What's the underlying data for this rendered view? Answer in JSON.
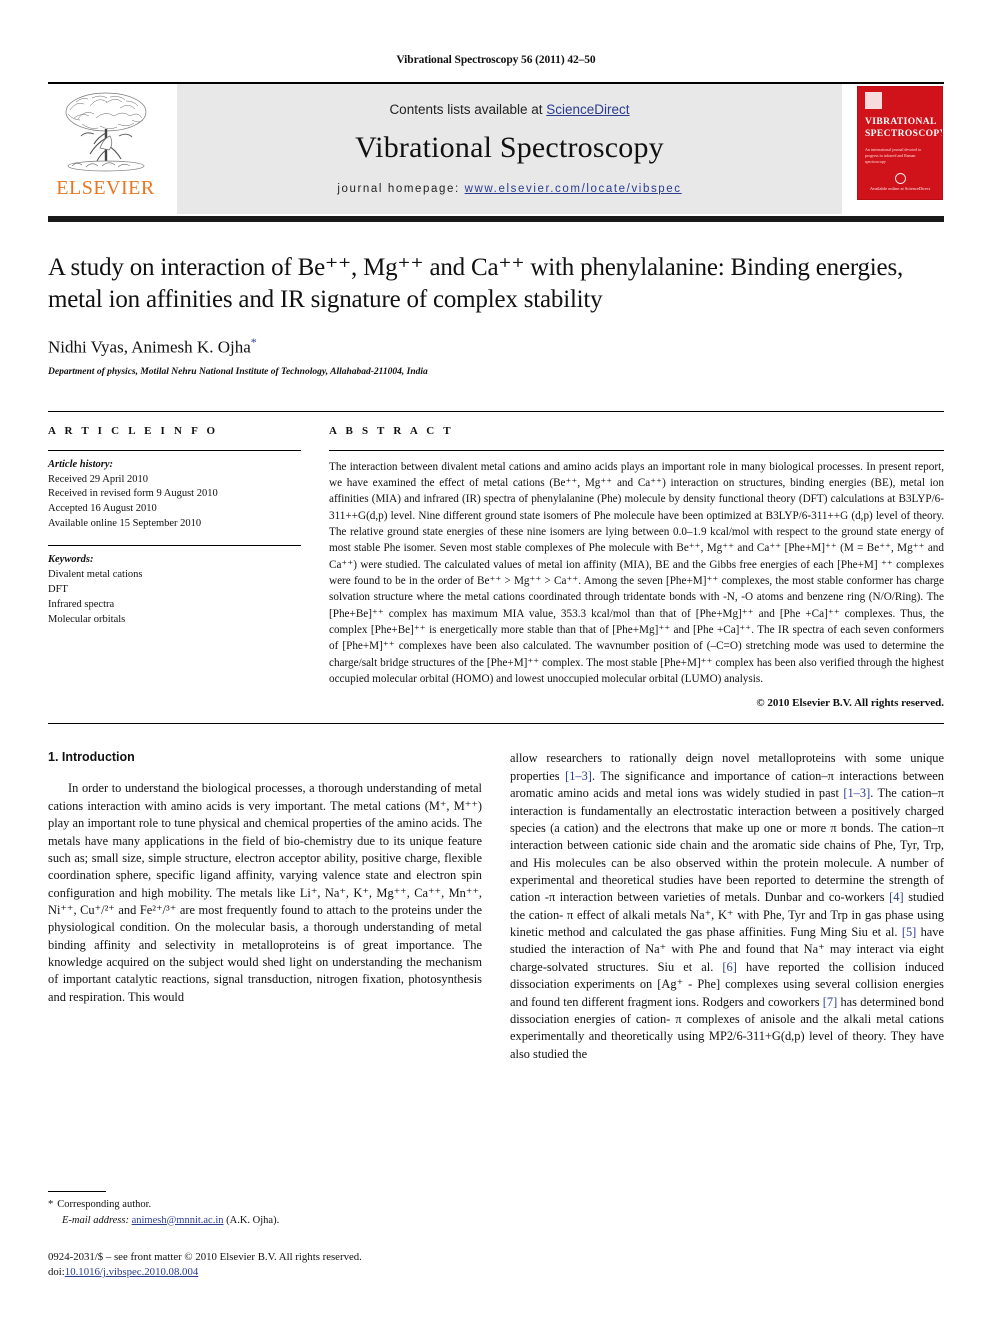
{
  "running_head": "Vibrational Spectroscopy 56 (2011) 42–50",
  "masthead": {
    "publisher_name": "ELSEVIER",
    "contents_prefix": "Contents lists available at ",
    "contents_link": "ScienceDirect",
    "journal_name": "Vibrational Spectroscopy",
    "homepage_label": "journal homepage: ",
    "homepage_url": "www.elsevier.com/locate/vibspec",
    "cover": {
      "title_line1": "VIBRATIONAL",
      "title_line2": "SPECTROSCOPY",
      "subtitle": "An international journal devoted to progress in infrared and Raman spectroscopy",
      "footer": "Available online at ScienceDirect"
    }
  },
  "article": {
    "title": "A study on interaction of Be⁺⁺, Mg⁺⁺ and Ca⁺⁺ with phenylalanine: Binding energies, metal ion affinities and IR signature of complex stability",
    "authors": "Nidhi Vyas, Animesh K. Ojha",
    "corresponding_marker": "*",
    "affiliation": "Department of physics, Motilal Nehru National Institute of Technology, Allahabad-211004, India"
  },
  "article_info": {
    "heading": "A R T I C L E   I N F O",
    "history_label": "Article history:",
    "history": [
      "Received 29 April 2010",
      "Received in revised form 9 August 2010",
      "Accepted 16 August 2010",
      "Available online 15 September 2010"
    ],
    "keywords_label": "Keywords:",
    "keywords": [
      "Divalent metal cations",
      "DFT",
      "Infrared spectra",
      "Molecular orbitals"
    ]
  },
  "abstract": {
    "heading": "A B S T R A C T",
    "text": "The interaction between divalent metal cations and amino acids plays an important role in many biological processes. In present report, we have examined the effect of metal cations (Be⁺⁺, Mg⁺⁺ and Ca⁺⁺) interaction on structures, binding energies (BE), metal ion affinities (MIA) and infrared (IR) spectra of phenylalanine (Phe) molecule by density functional theory (DFT) calculations at B3LYP/6-311++G(d,p) level. Nine different ground state isomers of Phe molecule have been optimized at B3LYP/6-311++G (d,p) level of theory. The relative ground state energies of these nine isomers are lying between 0.0–1.9 kcal/mol with respect to the ground state energy of most stable Phe isomer. Seven most stable complexes of Phe molecule with Be⁺⁺, Mg⁺⁺ and Ca⁺⁺ [Phe+M]⁺⁺ (M = Be⁺⁺, Mg⁺⁺ and Ca⁺⁺) were studied. The calculated values of metal ion affinity (MIA), BE and the Gibbs free energies of each [Phe+M] ⁺⁺ complexes were found to be in the order of Be⁺⁺ > Mg⁺⁺ > Ca⁺⁺. Among the seven [Phe+M]⁺⁺ complexes, the most stable conformer has charge solvation structure where the metal cations coordinated through tridentate bonds with -N, -O atoms and benzene ring (N/O/Ring). The [Phe+Be]⁺⁺ complex has maximum MIA value, 353.3 kcal/mol than that of [Phe+Mg]⁺⁺ and [Phe +Ca]⁺⁺ complexes. Thus, the complex [Phe+Be]⁺⁺ is energetically more stable than that of [Phe+Mg]⁺⁺ and [Phe +Ca]⁺⁺. The IR spectra of each seven conformers of [Phe+M]⁺⁺ complexes have been also calculated. The wavnumber position of (–C=O) stretching mode was used to determine the charge/salt bridge structures of the [Phe+M]⁺⁺ complex. The most stable [Phe+M]⁺⁺ complex has been also verified through the highest occupied molecular orbital (HOMO) and lowest unoccupied molecular orbital (LUMO) analysis.",
    "copyright": "© 2010 Elsevier B.V. All rights reserved."
  },
  "body": {
    "section_heading": "1.  Introduction",
    "left_paragraph_1": "In order to understand the biological processes, a thorough understanding of metal cations interaction with amino acids is very important. The metal cations (M⁺, M⁺⁺) play an important role to tune physical and chemical properties of the amino acids. The metals have many applications in the field of bio-chemistry due to its unique feature such as; small size, simple structure, electron acceptor ability, positive charge, flexible coordination sphere, specific ligand affinity, varying valence state and electron spin configuration and high mobility. The metals like Li⁺, Na⁺, K⁺, Mg⁺⁺, Ca⁺⁺, Mn⁺⁺, Ni⁺⁺, Cu⁺/²⁺ and Fe²⁺/³⁺ are most frequently found to attach to the proteins under the physiological condition. On the molecular basis, a thorough understanding of metal binding affinity and selectivity in metalloproteins is of great importance. The knowledge acquired on the subject would shed light on understanding the mechanism of important catalytic reactions, signal transduction, nitrogen fixation, photosynthesis and respiration. This would",
    "right_paragraph_segments": [
      {
        "t": "allow researchers to rationally deign novel metalloproteins with some unique properties ",
        "k": "text"
      },
      {
        "t": "[1–3]",
        "k": "ref"
      },
      {
        "t": ". The significance and importance of cation–π interactions between aromatic amino acids and metal ions was widely studied in past ",
        "k": "text"
      },
      {
        "t": "[1–3]",
        "k": "ref"
      },
      {
        "t": ". The cation–π interaction is fundamentally an electrostatic interaction between a positively charged species (a cation) and the electrons that make up one or more π bonds. The cation–π interaction between cationic side chain and the aromatic side chains of Phe, Tyr, Trp, and His molecules can be also observed within the protein molecule. A number of experimental and theoretical studies have been reported to determine the strength of cation -π interaction between varieties of metals. Dunbar and co-workers ",
        "k": "text"
      },
      {
        "t": "[4]",
        "k": "ref"
      },
      {
        "t": " studied the cation- π effect of alkali metals Na⁺, K⁺ with Phe, Tyr and Trp in gas phase using kinetic method and calculated the gas phase affinities. Fung Ming Siu et al. ",
        "k": "text"
      },
      {
        "t": "[5]",
        "k": "ref"
      },
      {
        "t": " have studied the interaction of Na⁺ with Phe and found that Na⁺ may interact via eight charge-solvated structures. Siu et al. ",
        "k": "text"
      },
      {
        "t": "[6]",
        "k": "ref"
      },
      {
        "t": " have reported the collision induced dissociation experiments on [Ag⁺ - Phe] complexes using several collision energies and found ten different fragment ions. Rodgers and coworkers ",
        "k": "text"
      },
      {
        "t": "[7]",
        "k": "ref"
      },
      {
        "t": " has determined bond dissociation energies of cation- π complexes of anisole and the alkali metal cations experimentally and theoretically using MP2/6-311+G(d,p) level of theory. They have also studied the",
        "k": "text"
      }
    ]
  },
  "footnotes": {
    "corresponding_star": "*",
    "corresponding_text": "Corresponding author.",
    "email_label": "E-mail address:",
    "email": "animesh@mnnit.ac.in",
    "email_suffix": "(A.K. Ojha).",
    "issn_line": "0924-2031/$ – see front matter © 2010 Elsevier B.V. All rights reserved.",
    "doi_label": "doi:",
    "doi_value": "10.1016/j.vibspec.2010.08.004"
  },
  "colors": {
    "link": "#2b3c8f",
    "elsevier_orange": "#E87722",
    "cover_red": "#d0121b",
    "banner_gray": "#e8e8e8"
  }
}
